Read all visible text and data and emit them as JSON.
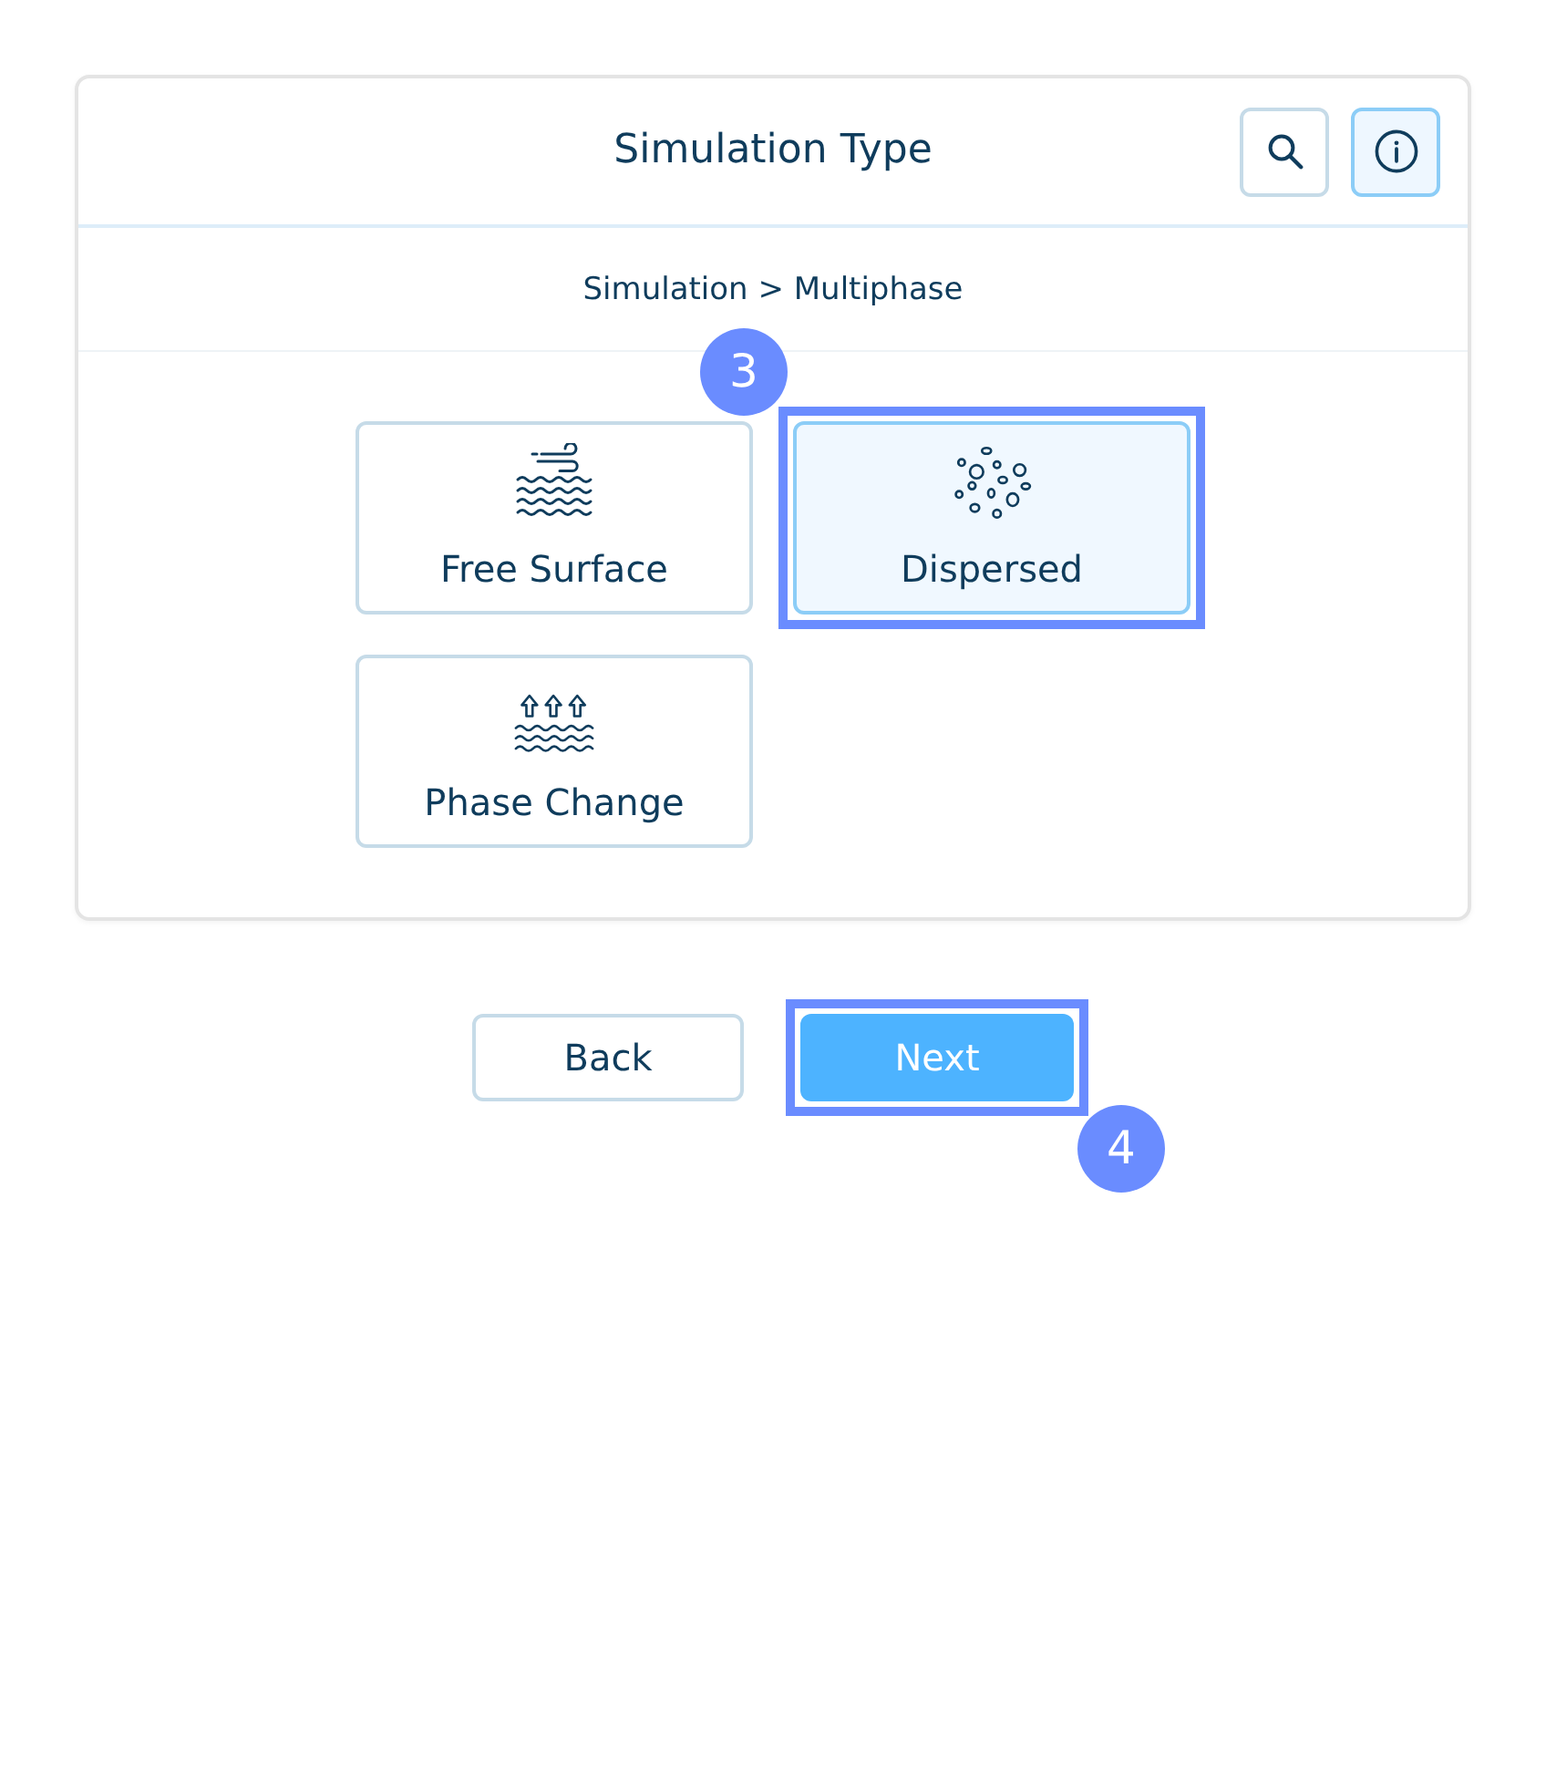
{
  "header": {
    "title": "Simulation Type",
    "actions": [
      {
        "kind": "search",
        "active": false
      },
      {
        "kind": "info",
        "active": true
      }
    ]
  },
  "breadcrumb": "Simulation > Multiphase",
  "options": [
    {
      "kind": "free-surface",
      "label": "Free Surface",
      "selected": false,
      "highlighted": false
    },
    {
      "kind": "dispersed",
      "label": "Dispersed",
      "selected": true,
      "highlighted": true,
      "step": "3"
    },
    {
      "kind": "phase-change",
      "label": "Phase Change",
      "selected": false,
      "highlighted": false
    }
  ],
  "buttons": [
    {
      "kind": "secondary",
      "label": "Back",
      "highlighted": false
    },
    {
      "kind": "primary",
      "label": "Next",
      "highlighted": true,
      "step": "4"
    }
  ]
}
